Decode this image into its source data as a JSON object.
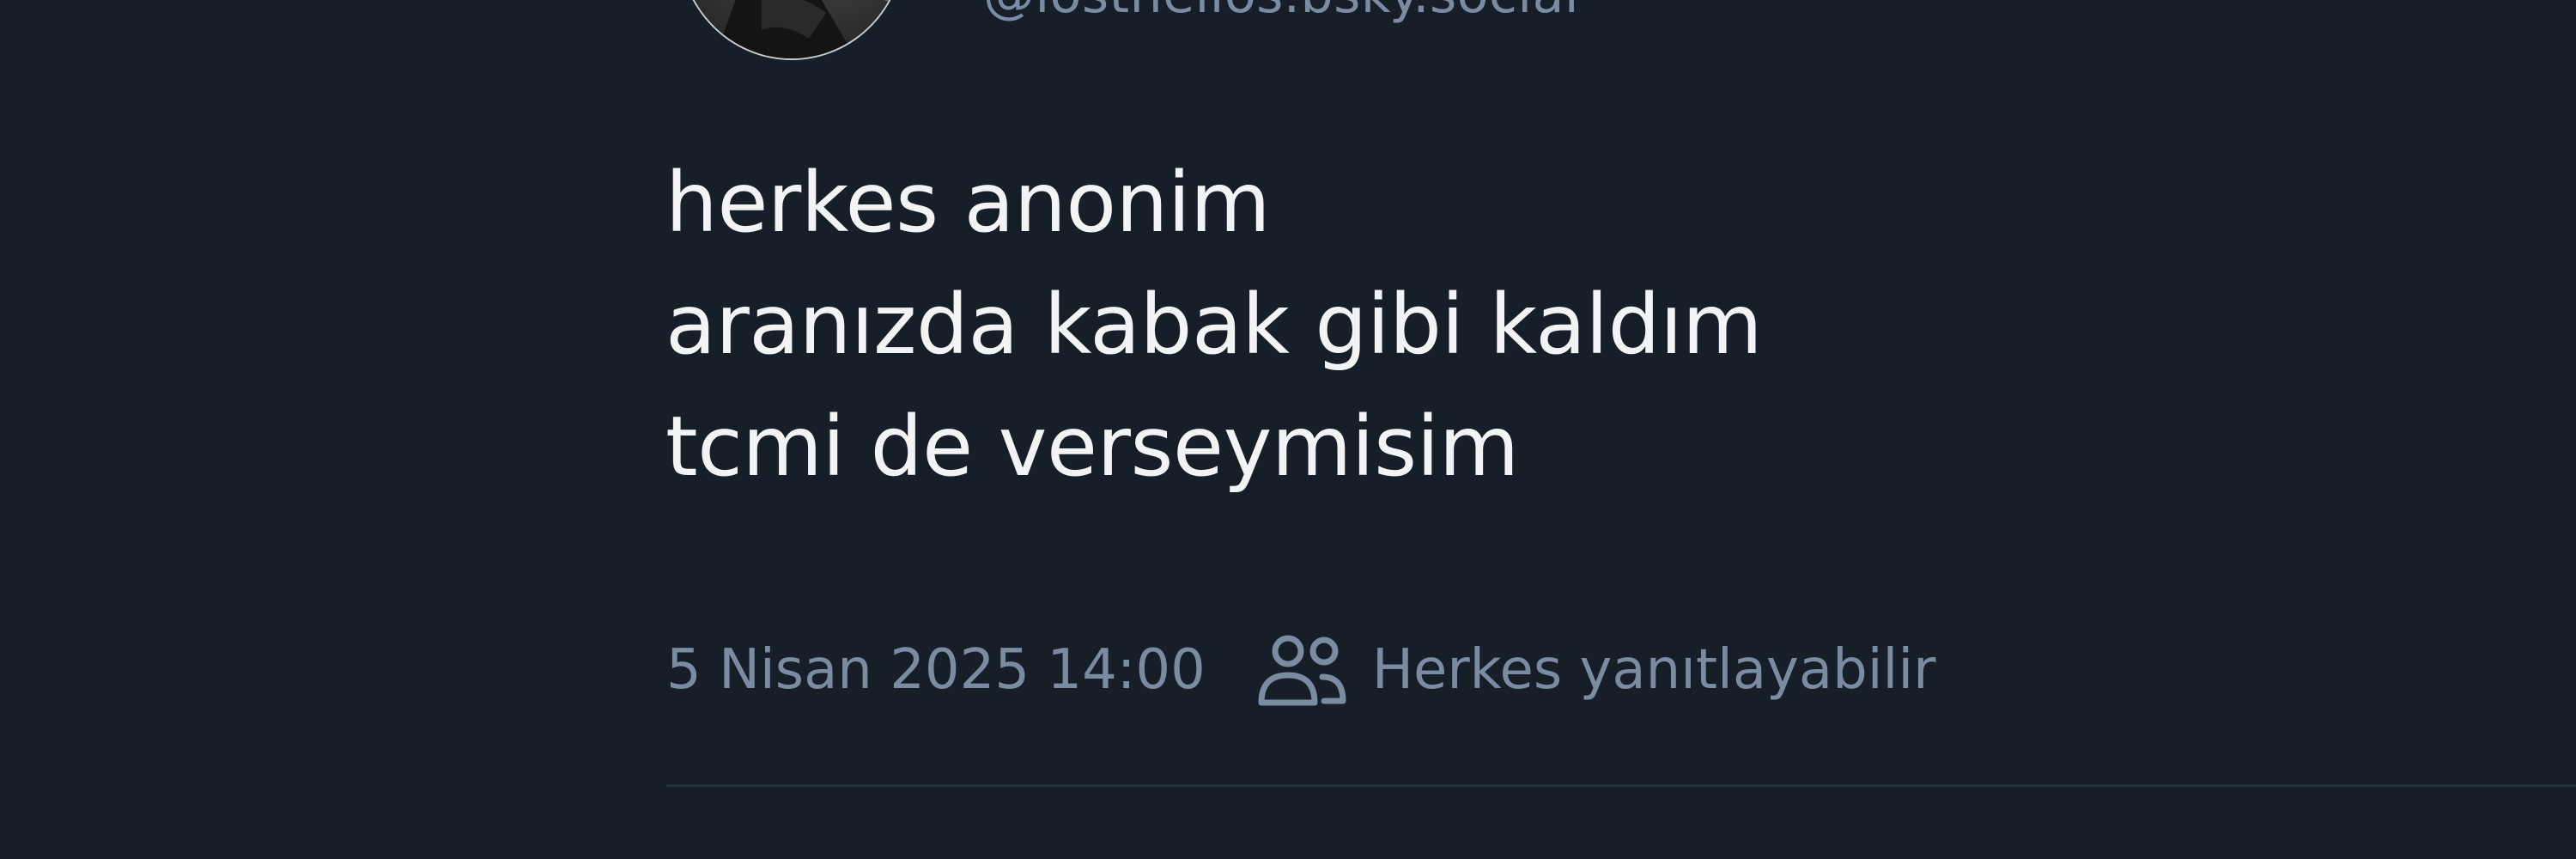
{
  "post": {
    "handle": "@losthelios.bsky.social",
    "text_lines": [
      "herkes anonim",
      "aranızda kabak gibi kaldım",
      "tcmi de verseymisim"
    ],
    "timestamp": "5 Nisan 2025 14:00",
    "reply_setting_label": "Herkes yanıtlayabilir",
    "reply_setting_icon": "people-icon"
  },
  "colors": {
    "background": "#161e27",
    "text": "#f1f3f5",
    "muted": "#7a8ba2",
    "divider": "#24303d"
  }
}
